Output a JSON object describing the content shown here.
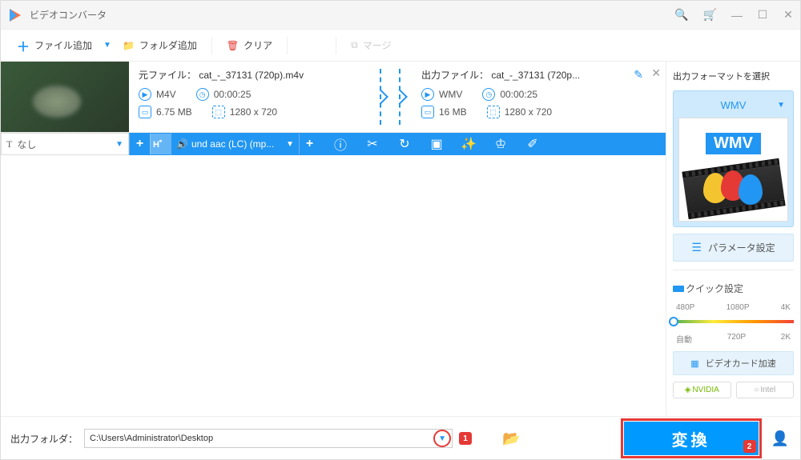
{
  "title": "ビデオコンバータ",
  "toolbar": {
    "add_file": "ファイル追加",
    "add_folder": "フォルダ追加",
    "clear": "クリア",
    "merge": "マージ"
  },
  "file": {
    "src_label": "元ファイル：",
    "src_name": "cat_-_37131 (720p).m4v",
    "src_format": "M4V",
    "src_duration": "00:00:25",
    "src_size": "6.75 MB",
    "src_res": "1280 x 720",
    "out_label": "出力ファイル：",
    "out_name": "cat_-_37131 (720p...",
    "out_format": "WMV",
    "out_duration": "00:00:25",
    "out_size": "16 MB",
    "out_res": "1280 x 720"
  },
  "subtoolbar": {
    "subtitle": "なし",
    "audio": "und aac (LC) (mp..."
  },
  "right": {
    "title": "出力フォーマットを選択",
    "format": "WMV",
    "params": "パラメータ設定",
    "quick": "クイック設定",
    "q480": "480P",
    "q1080": "1080P",
    "q4k": "4K",
    "qauto": "自動",
    "q720": "720P",
    "q2k": "2K",
    "gpu": "ビデオカード加速",
    "nvidia": "NVIDIA",
    "intel": "Intel"
  },
  "bottom": {
    "label": "出力フォルダ：",
    "path": "C:\\Users\\Administrator\\Desktop",
    "marker1": "1",
    "convert": "変換",
    "marker2": "2"
  }
}
